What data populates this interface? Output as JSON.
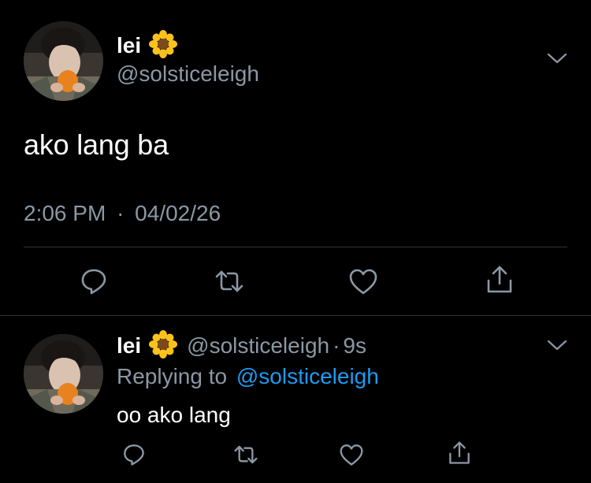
{
  "main_tweet": {
    "display_name": "lei",
    "name_emoji": "sunflower",
    "handle": "@solsticeleigh",
    "text": "ako lang ba",
    "time": "2:06 PM",
    "separator": "·",
    "date": "04/02/26"
  },
  "actions": {
    "icons": [
      "reply-icon",
      "retweet-icon",
      "like-icon",
      "share-icon"
    ]
  },
  "reply_tweet": {
    "display_name": "lei",
    "name_emoji": "sunflower",
    "handle": "@solsticeleigh",
    "separator": "·",
    "age": "9s",
    "replying_prefix": "Replying to",
    "replying_to": "@solsticeleigh",
    "text": "oo ako lang"
  },
  "colors": {
    "background": "#000000",
    "text": "#ffffff",
    "secondary": "#8b98a5",
    "link": "#1d9bf0",
    "divider": "#2f3336"
  }
}
